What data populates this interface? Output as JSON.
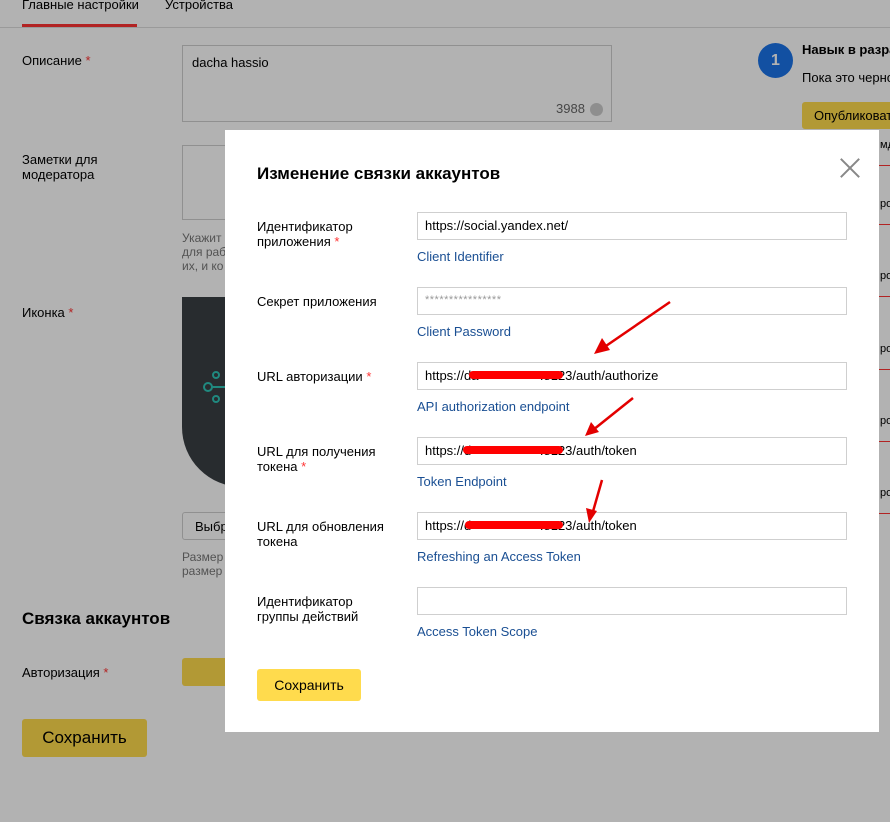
{
  "tabs": [
    {
      "label": "Главные настройки"
    },
    {
      "label": "Устройства"
    }
  ],
  "form": {
    "description_label": "Описание",
    "description_value": "dacha hassio",
    "description_counter": "3988",
    "notes_label": "Заметки для модератора",
    "notes_hint_lines": [
      "Укажит",
      "для раб",
      "их, и ко"
    ],
    "icon_label": "Иконка",
    "choose_button": "Выбр",
    "size_hint_lines": [
      "Размер",
      "размер"
    ],
    "accounts_heading": "Связка аккаунтов",
    "auth_label": "Авторизация",
    "save_button": "Сохранить",
    "required_mark": "*"
  },
  "right_panel": {
    "step_number": "1",
    "title": "Навык в разра",
    "text": "Пока это черно",
    "publish_button": "Опубликоват",
    "fragments": [
      "мд",
      "ро",
      "ро",
      "ро",
      "ро",
      "ро"
    ]
  },
  "modal": {
    "title": "Изменение связки аккаунтов",
    "fields": [
      {
        "label": "Идентификатор приложения",
        "required": true,
        "value": "https://social.yandex.net/",
        "link": "Client Identifier"
      },
      {
        "label": "Секрет приложения",
        "required": false,
        "value": "****************",
        "link": "Client Password"
      },
      {
        "label": "URL авторизации",
        "required": true,
        "value": "https://da                 :8123/auth/authorize",
        "link": "API authorization endpoint"
      },
      {
        "label": "URL для получения токена",
        "required": true,
        "value": "https://d                   :8123/auth/token",
        "link": "Token Endpoint"
      },
      {
        "label": "URL для обновления токена",
        "required": false,
        "value": "https://d                   :8123/auth/token",
        "link": "Refreshing an Access Token"
      },
      {
        "label": "Идентификатор группы действий",
        "required": false,
        "value": "",
        "link": "Access Token Scope"
      }
    ],
    "save_button": "Сохранить"
  },
  "colors": {
    "accent_yellow": "#ffdb4d",
    "link_blue": "#1a4f93",
    "required_red": "#ff3333",
    "annotation_red": "#e30000"
  }
}
